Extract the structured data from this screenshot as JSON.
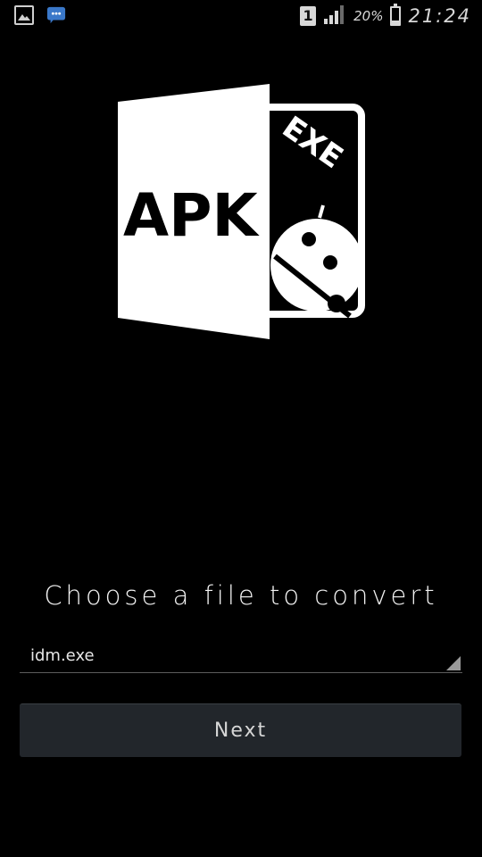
{
  "status_bar": {
    "left_icons": [
      "gallery-notification-icon",
      "messaging-notification-icon"
    ],
    "sim_slot": "1",
    "battery_percent": "20%",
    "battery_level": 0.2,
    "time": "21:24"
  },
  "logo": {
    "primary_text": "APK",
    "secondary_text": "EXE"
  },
  "form": {
    "prompt": "Choose a file to convert",
    "selected_file": "idm.exe",
    "next_label": "Next"
  },
  "colors": {
    "background": "#000000",
    "text": "#ffffff",
    "button_bg": "#22262b"
  }
}
